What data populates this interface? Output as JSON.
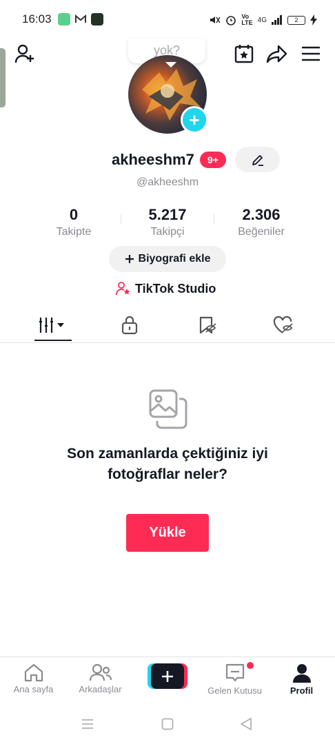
{
  "status_bar": {
    "time": "16:03",
    "battery": "2",
    "network": "4G"
  },
  "header": {
    "tooltip": "yok?"
  },
  "profile": {
    "username": "akheeshm7",
    "badge": "9+",
    "handle": "@akheeshm"
  },
  "stats": [
    {
      "value": "0",
      "label": "Takipte"
    },
    {
      "value": "5.217",
      "label": "Takipçi"
    },
    {
      "value": "2.306",
      "label": "Beğeniler"
    }
  ],
  "bio_button": "Biyografi ekle",
  "studio_link": "TikTok Studio",
  "empty_state": {
    "title": "Son zamanlarda çektiğiniz iyi fotoğraflar neler?",
    "button": "Yükle"
  },
  "bottom_nav": [
    {
      "label": "Ana sayfa",
      "icon": "home-icon"
    },
    {
      "label": "Arkadaşlar",
      "icon": "friends-icon"
    },
    {
      "label": "",
      "icon": "create-icon"
    },
    {
      "label": "Gelen Kutusu",
      "icon": "inbox-icon"
    },
    {
      "label": "Profil",
      "icon": "profile-icon"
    }
  ],
  "colors": {
    "accent": "#fe2c55",
    "cyan": "#20d5ec",
    "text": "#161823",
    "muted": "#8a8b91"
  }
}
